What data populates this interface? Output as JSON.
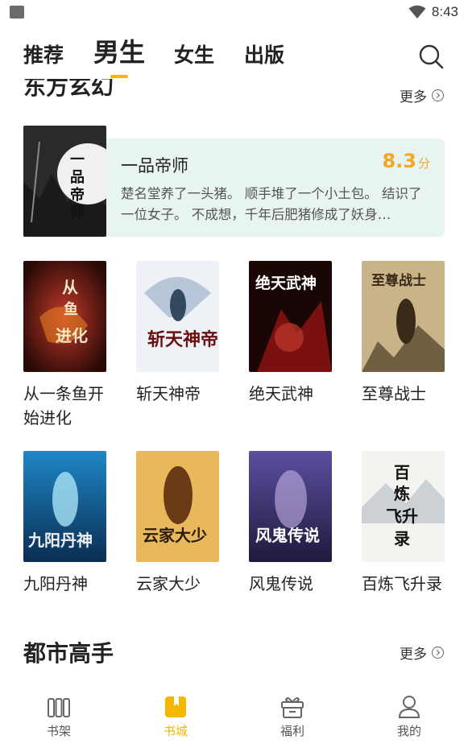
{
  "status_bar": {
    "time": "8:43"
  },
  "tabs": [
    {
      "label": "推荐"
    },
    {
      "label": "男生",
      "active": true
    },
    {
      "label": "女生"
    },
    {
      "label": "出版"
    }
  ],
  "sections": [
    {
      "title": "东方玄幻",
      "more_label": "更多",
      "featured": {
        "title": "一品帝师",
        "score": "8.3",
        "score_unit": "分",
        "description": "楚名堂养了一头猪。 顺手堆了一个小土包。 结识了一位女子。 不成想，千年后肥猪修成了妖身…",
        "cover_text": "一品帝师"
      },
      "books": [
        {
          "title": "从一条鱼开始进化",
          "cover_text": "从一条鱼开始进化"
        },
        {
          "title": "斩天神帝",
          "cover_text": "斩天神帝"
        },
        {
          "title": "绝天武神",
          "cover_text": "绝天武神"
        },
        {
          "title": "至尊战士",
          "cover_text": "至尊战士"
        },
        {
          "title": "九阳丹神",
          "cover_text": "九阳丹神"
        },
        {
          "title": "云家大少",
          "cover_text": "云家大少"
        },
        {
          "title": "风鬼传说",
          "cover_text": "风鬼传说"
        },
        {
          "title": "百炼飞升录",
          "cover_text": "百炼飞升录"
        }
      ]
    },
    {
      "title": "都市高手",
      "more_label": "更多"
    }
  ],
  "bottom_nav": [
    {
      "label": "书架",
      "icon": "bookshelf-icon"
    },
    {
      "label": "书城",
      "icon": "bookstore-icon",
      "active": true
    },
    {
      "label": "福利",
      "icon": "gift-icon"
    },
    {
      "label": "我的",
      "icon": "profile-icon"
    }
  ],
  "colors": {
    "accent": "#f5b800",
    "score": "#f5a623",
    "featured_bg": "#e8f4ef"
  }
}
